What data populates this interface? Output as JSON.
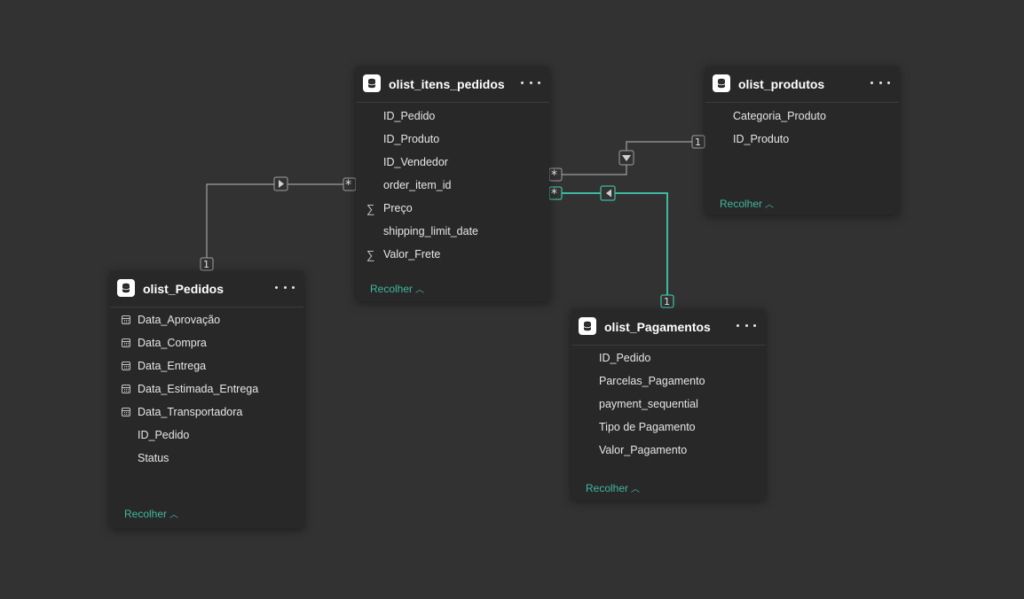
{
  "tables": {
    "itens": {
      "title": "olist_itens_pedidos",
      "fields": [
        "ID_Pedido",
        "ID_Produto",
        "ID_Vendedor",
        "order_item_id",
        "Preço",
        "shipping_limit_date",
        "Valor_Frete"
      ],
      "collapse_label": "Recolher"
    },
    "produtos": {
      "title": "olist_produtos",
      "fields": [
        "Categoria_Produto",
        "ID_Produto"
      ],
      "collapse_label": "Recolher"
    },
    "pedidos": {
      "title": "olist_Pedidos",
      "fields": [
        "Data_Aprovação",
        "Data_Compra",
        "Data_Entrega",
        "Data_Estimada_Entrega",
        "Data_Transportadora",
        "ID_Pedido",
        "Status"
      ],
      "collapse_label": "Recolher"
    },
    "pagamentos": {
      "title": "olist_Pagamentos",
      "fields": [
        "ID_Pedido",
        "Parcelas_Pagamento",
        "payment_sequential",
        "Tipo de Pagamento",
        "Valor_Pagamento"
      ],
      "collapse_label": "Recolher"
    }
  },
  "relationships": {
    "one_label": "1",
    "many_label": "*"
  },
  "colors": {
    "background": "#323232",
    "card": "#282828",
    "accent": "#3fb8a0",
    "line": "#a0a0a0"
  },
  "icons": {
    "table": "database-icon",
    "more": "more-options-icon",
    "sum": "sigma-icon",
    "date": "calendar-icon",
    "collapse": "chevron-up-icon"
  }
}
